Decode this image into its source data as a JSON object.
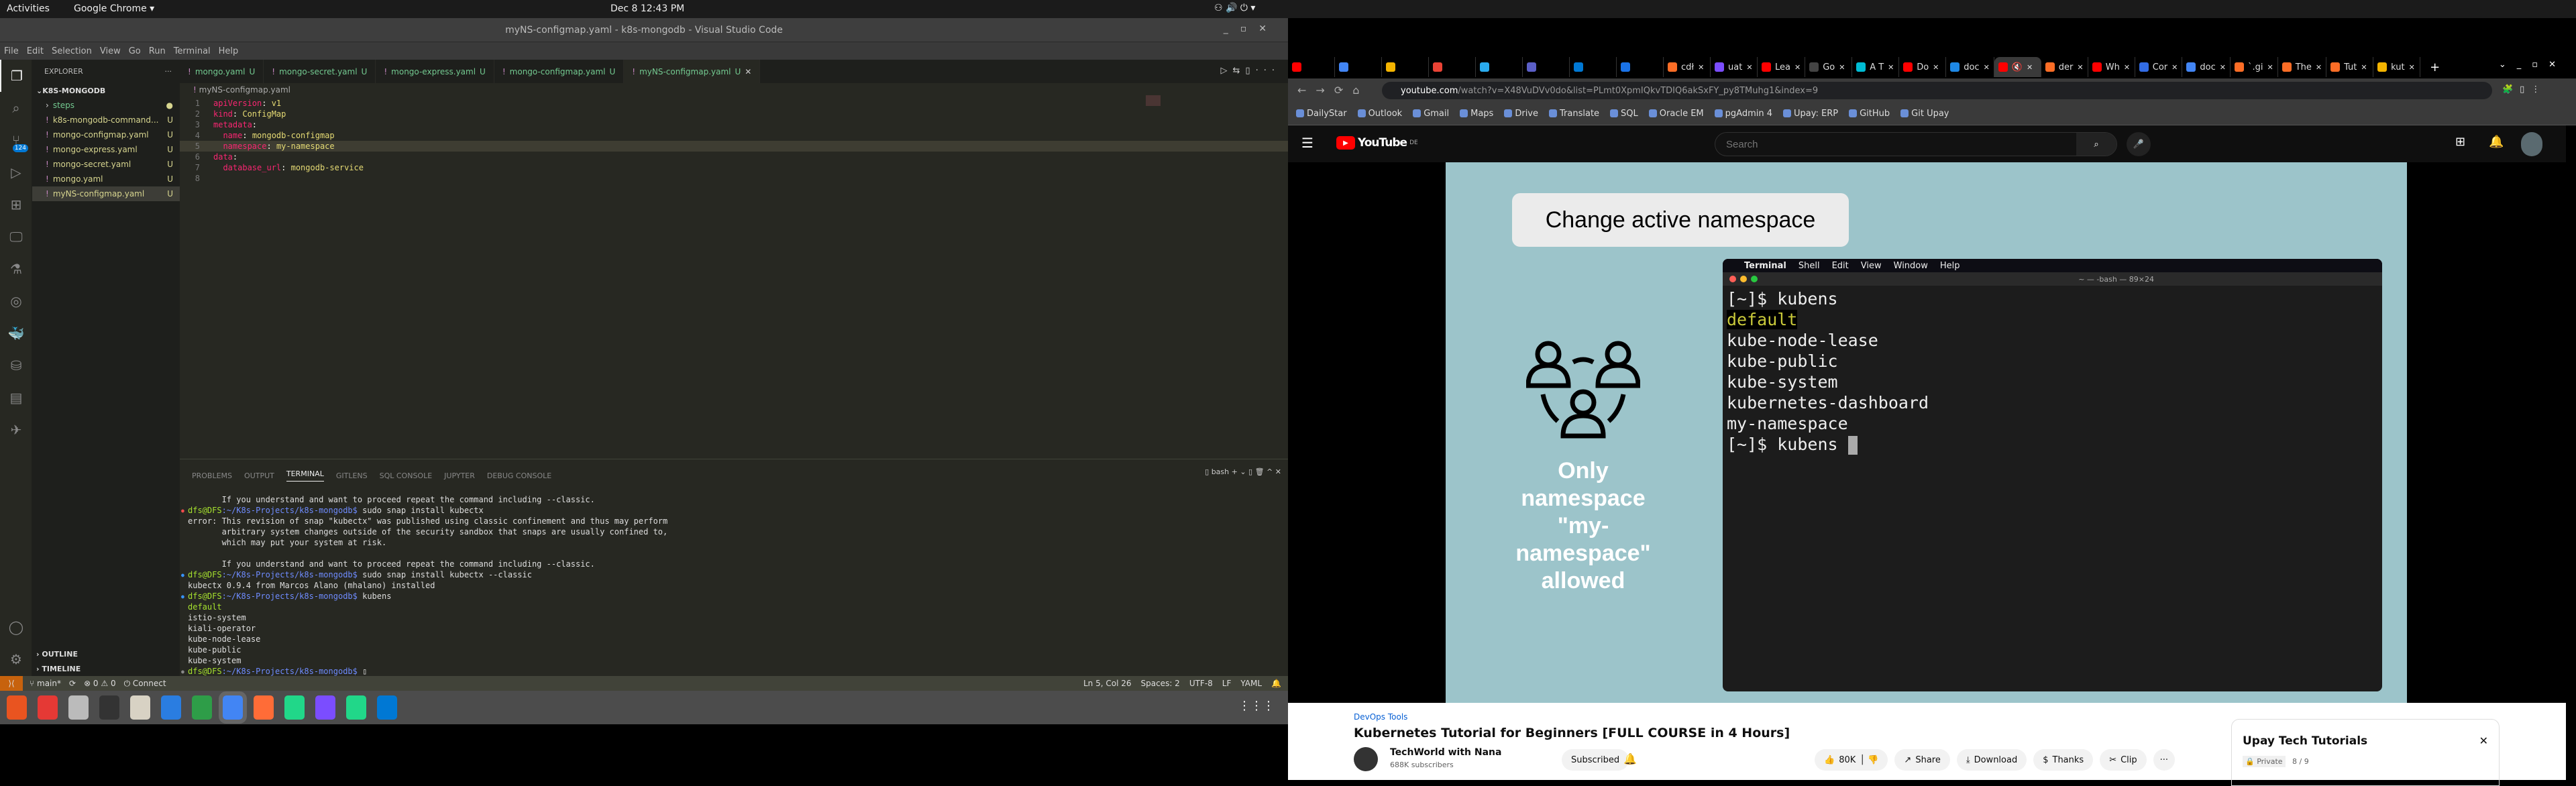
{
  "system": {
    "activities": "Activities",
    "app": "Google Chrome ▾",
    "clock": "Dec 8  12:43 PM"
  },
  "vscode": {
    "title": "myNS-configmap.yaml - k8s-mongodb - Visual Studio Code",
    "menu": [
      "File",
      "Edit",
      "Selection",
      "View",
      "Go",
      "Run",
      "Terminal",
      "Help"
    ],
    "explorer_label": "EXPLORER",
    "project": "K8S-MONGODB",
    "files": [
      {
        "name": "steps",
        "badge": "●",
        "type": "folder"
      },
      {
        "name": "k8s-mongodb-command...",
        "badge": "U"
      },
      {
        "name": "mongo-configmap.yaml",
        "badge": "U"
      },
      {
        "name": "mongo-express.yaml",
        "badge": "U"
      },
      {
        "name": "mongo-secret.yaml",
        "badge": "U"
      },
      {
        "name": "mongo.yaml",
        "badge": "U"
      },
      {
        "name": "myNS-configmap.yaml",
        "badge": "U",
        "active": true
      }
    ],
    "outline": "OUTLINE",
    "timeline": "TIMELINE",
    "scm_badge": "124",
    "tabs": [
      {
        "name": "mongo.yaml",
        "badge": "U"
      },
      {
        "name": "mongo-secret.yaml",
        "badge": "U"
      },
      {
        "name": "mongo-express.yaml",
        "badge": "U"
      },
      {
        "name": "mongo-configmap.yaml",
        "badge": "U"
      },
      {
        "name": "myNS-configmap.yaml",
        "badge": "U",
        "active": true
      }
    ],
    "breadcrumb": "myNS-configmap.yaml",
    "code": [
      {
        "indent": "",
        "key": "apiVersion",
        "val": "v1"
      },
      {
        "indent": "",
        "key": "kind",
        "val": "ConfigMap"
      },
      {
        "indent": "",
        "key": "metadata",
        "val": ""
      },
      {
        "indent": "  ",
        "key": "name",
        "val": "mongodb-configmap"
      },
      {
        "indent": "  ",
        "key": "namespace",
        "val": "my-namespace"
      },
      {
        "indent": "",
        "key": "data",
        "val": ""
      },
      {
        "indent": "  ",
        "key": "database_url",
        "val": "mongodb-service"
      },
      {
        "indent": "",
        "key": "",
        "val": ""
      }
    ],
    "panel_tabs": [
      "PROBLEMS",
      "OUTPUT",
      "TERMINAL",
      "GITLENS",
      "SQL CONSOLE",
      "JUPYTER",
      "DEBUG CONSOLE"
    ],
    "panel_active": "TERMINAL",
    "shell": "bash",
    "terminal": [
      {
        "text": "       If you understand and want to proceed repeat the command including --classic."
      },
      {
        "prompt": "dfs@DFS",
        "path": ":~/K8s-Projects/k8s-mongodb$",
        "text": " sudo snap install kubectx",
        "dot": "#f14c4c"
      },
      {
        "text": "error: This revision of snap \"kubectx\" was published using classic confinement and thus may perform"
      },
      {
        "text": "       arbitrary system changes outside of the security sandbox that snaps are usually confined to,"
      },
      {
        "text": "       which may put your system at risk."
      },
      {
        "text": ""
      },
      {
        "text": "       If you understand and want to proceed repeat the command including --classic."
      },
      {
        "prompt": "dfs@DFS",
        "path": ":~/K8s-Projects/k8s-mongodb$",
        "text": " sudo snap install kubectx --classic",
        "dot": "#3794ff"
      },
      {
        "text": "kubectx 0.9.4 from Marcos Alano (mhalano) installed"
      },
      {
        "prompt": "dfs@DFS",
        "path": ":~/K8s-Projects/k8s-mongodb$",
        "text": " kubens",
        "dot": "#3794ff"
      },
      {
        "text": "default",
        "highlight": true
      },
      {
        "text": "istio-system"
      },
      {
        "text": "kiali-operator"
      },
      {
        "text": "kube-node-lease"
      },
      {
        "text": "kube-public"
      },
      {
        "text": "kube-system"
      },
      {
        "prompt": "dfs@DFS",
        "path": ":~/K8s-Projects/k8s-mongodb$",
        "text": " ▯",
        "dot": "#888"
      }
    ],
    "status": {
      "branch": "main*",
      "problems": "⊗ 0 ⚠ 0",
      "connect": "Connect",
      "position": "Ln 5, Col 26",
      "spaces": "Spaces: 2",
      "encoding": "UTF-8",
      "eol": "LF",
      "language": "YAML"
    }
  },
  "dock": {
    "colors": [
      "#e95420",
      "#e53935",
      "#bbbbbb",
      "#333333",
      "#d8d2c4",
      "#2a7de1",
      "#2e9d48",
      "#4285f4",
      "#ff6c37",
      "#21d789",
      "#7b4dff",
      "#21d789",
      "#0078d4"
    ]
  },
  "chrome": {
    "tabs": [
      {
        "label": "",
        "color": "#ff0000"
      },
      {
        "label": "",
        "color": "#4285f4"
      },
      {
        "label": "",
        "color": "#f4b400"
      },
      {
        "label": "",
        "color": "#ea4335"
      },
      {
        "label": "",
        "color": "#2aabee"
      },
      {
        "label": "",
        "color": "#5b5fc7"
      },
      {
        "label": "",
        "color": "#0078d4"
      },
      {
        "label": "",
        "color": "#1a73e8"
      },
      {
        "label": "cdł",
        "color": "#fc6d26"
      },
      {
        "label": "uat",
        "color": "#7b4dff"
      },
      {
        "label": "Lea",
        "color": "#ff0000"
      },
      {
        "label": "Go",
        "color": "#444"
      },
      {
        "label": "A T",
        "color": "#00bcd4"
      },
      {
        "label": "Do",
        "color": "#ff0000"
      },
      {
        "label": "doc",
        "color": "#1e88e5"
      },
      {
        "label": "🔇",
        "color": "#ff0000",
        "active": true
      },
      {
        "label": "der",
        "color": "#fc6d26"
      },
      {
        "label": "Wh",
        "color": "#ff0000"
      },
      {
        "label": "Cor",
        "color": "#326ce5"
      },
      {
        "label": "doc",
        "color": "#4285f4"
      },
      {
        "label": "`.gi",
        "color": "#fc6d26"
      },
      {
        "label": "The",
        "color": "#fc6d26"
      },
      {
        "label": "Tut",
        "color": "#fc6d26"
      },
      {
        "label": "kut",
        "color": "#f4b400"
      }
    ],
    "url_host": "youtube.com",
    "url_path": "/watch?v=X48VuDVv0do&list=PLmt0XpmIQkvTDIQ6akSxFY_py8TMuhg1&index=9",
    "bookmarks": [
      "DailyStar",
      "Outlook",
      "Gmail",
      "Maps",
      "Drive",
      "Translate",
      "SQL",
      "Oracle EM",
      "pgAdmin 4",
      "Upay: ERP",
      "GitHub",
      "Git Upay"
    ]
  },
  "youtube": {
    "logo": "YouTube",
    "region": "DE",
    "search_placeholder": "Search",
    "slide": {
      "heading": "Change active namespace",
      "caption": [
        "Only namespace",
        "\"my-namespace\"",
        "allowed"
      ],
      "mac_menu": [
        "Terminal",
        "Shell",
        "Edit",
        "View",
        "Window",
        "Help"
      ],
      "window_title": "~ — -bash — 89×24",
      "lines": [
        "[~]$ kubens",
        "default",
        "kube-node-lease",
        "kube-public",
        "kube-system",
        "kubernetes-dashboard",
        "my-namespace",
        "[~]$ kubens "
      ]
    },
    "hashtag": "DevOps Tools",
    "title": "Kubernetes Tutorial for Beginners [FULL COURSE in 4 Hours]",
    "channel": "TechWorld with Nana",
    "subscribers": "688K subscribers",
    "subscribed": "Subscribed",
    "likes": "80K",
    "share": "Share",
    "download": "Download",
    "thanks": "Thanks",
    "clip": "Clip",
    "more": "···",
    "playlist": {
      "title": "Upay Tech Tutorials",
      "privacy": "Private",
      "position": "8 / 9"
    },
    "accent": "#ff0000"
  }
}
